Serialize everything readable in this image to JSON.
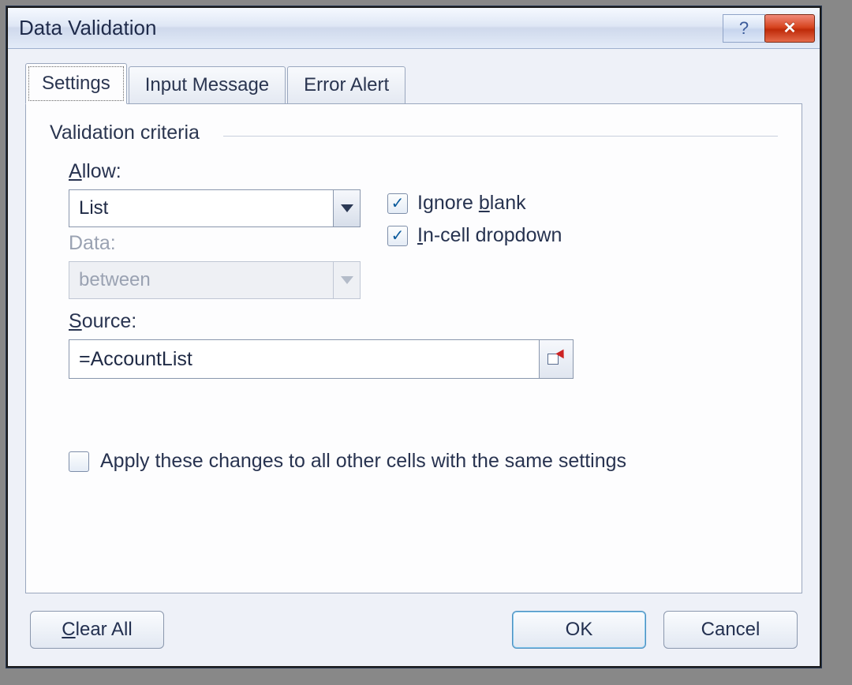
{
  "title": "Data Validation",
  "tabs": {
    "settings": "Settings",
    "input_message": "Input Message",
    "error_alert": "Error Alert"
  },
  "group_label": "Validation criteria",
  "allow": {
    "label_prefix": "A",
    "label_rest": "llow:",
    "value": "List"
  },
  "data": {
    "label": "Data:",
    "value": "between"
  },
  "checks": {
    "ignore_blank_pre": "Ignore ",
    "ignore_blank_u": "b",
    "ignore_blank_post": "lank",
    "incell_u": "I",
    "incell_post": "n-cell dropdown"
  },
  "source": {
    "label_u": "S",
    "label_rest": "ource:",
    "value": "=AccountList"
  },
  "apply_label": "Apply these changes to all other cells with the same settings",
  "buttons": {
    "clear_u": "C",
    "clear_rest": "lear All",
    "ok": "OK",
    "cancel": "Cancel"
  }
}
